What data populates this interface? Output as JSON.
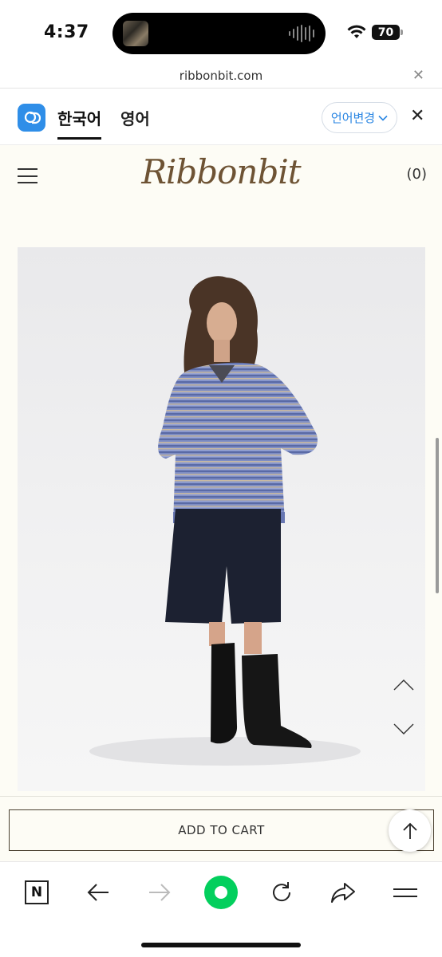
{
  "status": {
    "time": "4:37",
    "battery": "70",
    "icons": [
      "now-playing-thumbnail",
      "audio-waveform-icon",
      "wifi-icon",
      "battery-icon"
    ]
  },
  "browser": {
    "url": "ribbonbit.com",
    "url_close_icon": "close-icon"
  },
  "translate": {
    "logo_icon": "papago-translate-icon",
    "tabs": [
      {
        "label": "한국어",
        "active": true
      },
      {
        "label": "영어",
        "active": false
      }
    ],
    "change_label": "언어변경",
    "change_icon": "chevron-down-icon",
    "close_icon": "close-icon"
  },
  "site": {
    "menu_icon": "hamburger-menu-icon",
    "brand": "Ribbonbit",
    "cart_count": "(0)"
  },
  "product": {
    "image_alt": "model wearing striped long-sleeve henley shirt, navy shorts and black boots",
    "slide_up_icon": "chevron-up-icon",
    "slide_down_icon": "chevron-down-icon"
  },
  "cart": {
    "add_to_cart": "ADD TO CART",
    "scroll_top_icon": "arrow-up-icon"
  },
  "toolbar": {
    "n_label": "N",
    "icons": [
      "naver-n-icon",
      "back-arrow-icon",
      "forward-arrow-icon",
      "home-green-dot-icon",
      "reload-icon",
      "share-icon",
      "menu-icon"
    ]
  },
  "colors": {
    "page_bg": "#fdfcf5",
    "brand": "#6e5334",
    "translate_blue": "#2a86e3",
    "naver_green": "#03cf5d"
  }
}
